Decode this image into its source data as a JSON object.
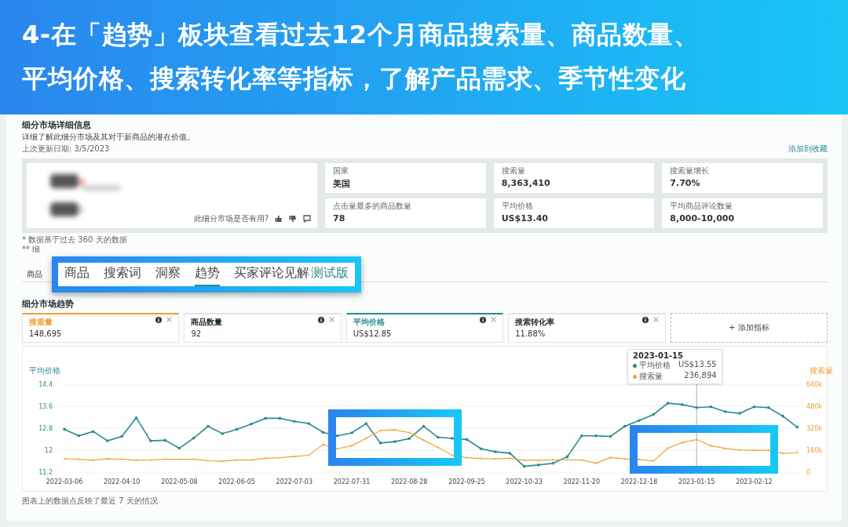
{
  "banner": {
    "lines": [
      "4-在「趋势」板块查看过去12个月商品搜索量、商品数量、",
      "平均价格、搜索转化率等指标，了解产品需求、季节性变化"
    ]
  },
  "header": {
    "title": "细分市场详细信息",
    "description": "详细了解此细分市场及其对于新商品的潜在价值。",
    "updated": "上次更新日期: 3/5/2023",
    "link": "添加到收藏"
  },
  "overview": {
    "feedback_question": "此细分市场是否有用?"
  },
  "metrics": [
    {
      "label": "国家",
      "value": "美国"
    },
    {
      "label": "搜索量",
      "value": "8,363,410"
    },
    {
      "label": "搜索量增长",
      "value": "7.70%"
    },
    {
      "label": "点击量最多的商品数量",
      "value": "78"
    },
    {
      "label": "平均价格",
      "value": "US$13.40"
    },
    {
      "label": "平均商品评论数量",
      "value": "8,000-10,000"
    }
  ],
  "footnotes": [
    "* 数据基于过去 360 天的数据",
    "** 细"
  ],
  "page_tabs": [
    {
      "label": "商品"
    }
  ],
  "highlighted_tabs": [
    {
      "label": "商品",
      "selected": false
    },
    {
      "label": "搜索词",
      "selected": false
    },
    {
      "label": "洞察",
      "selected": false
    },
    {
      "label": "趋势",
      "selected": true
    },
    {
      "label": "买家评论见解",
      "selected": false,
      "badge": "测试版"
    }
  ],
  "trends": {
    "title": "细分市场趋势",
    "metric_cards": [
      {
        "label": "搜索量",
        "value": "148,695",
        "color": "#f0a030"
      },
      {
        "label": "商品数量",
        "value": "92"
      },
      {
        "label": "平均价格",
        "value": "US$12.85",
        "color": "#2a8a8f"
      },
      {
        "label": "搜索转化率",
        "value": "11.88%"
      }
    ],
    "add_metric": "+ 添加指标",
    "chart_data": {
      "type": "line",
      "ylabel": "平均价格",
      "y2label": "搜索量",
      "grid": true,
      "categories": [
        "2022-03-06",
        null,
        null,
        null,
        "2022-04-10",
        null,
        null,
        null,
        "2022-05-08",
        null,
        null,
        null,
        "2022-06-05",
        null,
        null,
        null,
        "2022-07-03",
        null,
        null,
        null,
        "2022-07-31",
        null,
        null,
        null,
        "2022-08-28",
        null,
        null,
        null,
        "2022-09-25",
        null,
        null,
        null,
        "2022-10-23",
        null,
        null,
        null,
        "2022-11-20",
        null,
        null,
        null,
        "2022-12-18",
        null,
        null,
        null,
        "2023-01-15",
        null,
        null,
        null,
        "2023-02-12",
        null,
        null,
        null
      ],
      "ylim": [
        11.2,
        14.4
      ],
      "yticks": [
        11.2,
        12,
        12.8,
        13.6,
        14.4
      ],
      "y2lim": [
        0,
        640000
      ],
      "y2ticks": [
        {
          "value": 0,
          "label": "0"
        },
        {
          "value": 160000,
          "label": "160k"
        },
        {
          "value": 320000,
          "label": "320k"
        },
        {
          "value": 480000,
          "label": "480k"
        },
        {
          "value": 640000,
          "label": "640k"
        }
      ],
      "series": [
        {
          "name": "平均价格",
          "color": "#2a8a8f",
          "values": [
            12.76,
            12.52,
            12.68,
            12.34,
            12.5,
            13.18,
            12.34,
            12.36,
            12.07,
            12.44,
            12.87,
            12.6,
            12.76,
            12.95,
            13.16,
            13.16,
            13.05,
            12.97,
            12.65,
            12.52,
            12.63,
            12.97,
            12.26,
            12.31,
            12.42,
            12.87,
            12.47,
            12.43,
            12.39,
            12.05,
            11.94,
            11.89,
            11.41,
            11.46,
            11.52,
            11.76,
            12.52,
            12.52,
            12.5,
            12.87,
            13.08,
            13.3,
            13.71,
            13.66,
            13.55,
            13.58,
            13.4,
            13.34,
            13.58,
            13.55,
            13.24,
            12.84
          ]
        },
        {
          "name": "搜索量",
          "color": "#f0a030",
          "axis": "y2",
          "values": [
            97000,
            94000,
            86000,
            96000,
            94000,
            86000,
            88000,
            94000,
            94000,
            94000,
            83000,
            79000,
            88000,
            88000,
            101000,
            105000,
            114000,
            123000,
            201000,
            170000,
            192000,
            246000,
            304000,
            308000,
            288000,
            232000,
            180000,
            123000,
            105000,
            99000,
            97000,
            101000,
            86000,
            86000,
            90000,
            90000,
            88000,
            65000,
            106000,
            96000,
            92000,
            81000,
            174000,
            215000,
            237000,
            192000,
            172000,
            161000,
            159000,
            159000,
            137000,
            143000
          ]
        }
      ]
    },
    "tooltip": {
      "date": "2023-01-15",
      "values": [
        "US$13.55",
        "236,894"
      ]
    },
    "note": "图表上的数据点反映了最近 7 天的情况"
  }
}
